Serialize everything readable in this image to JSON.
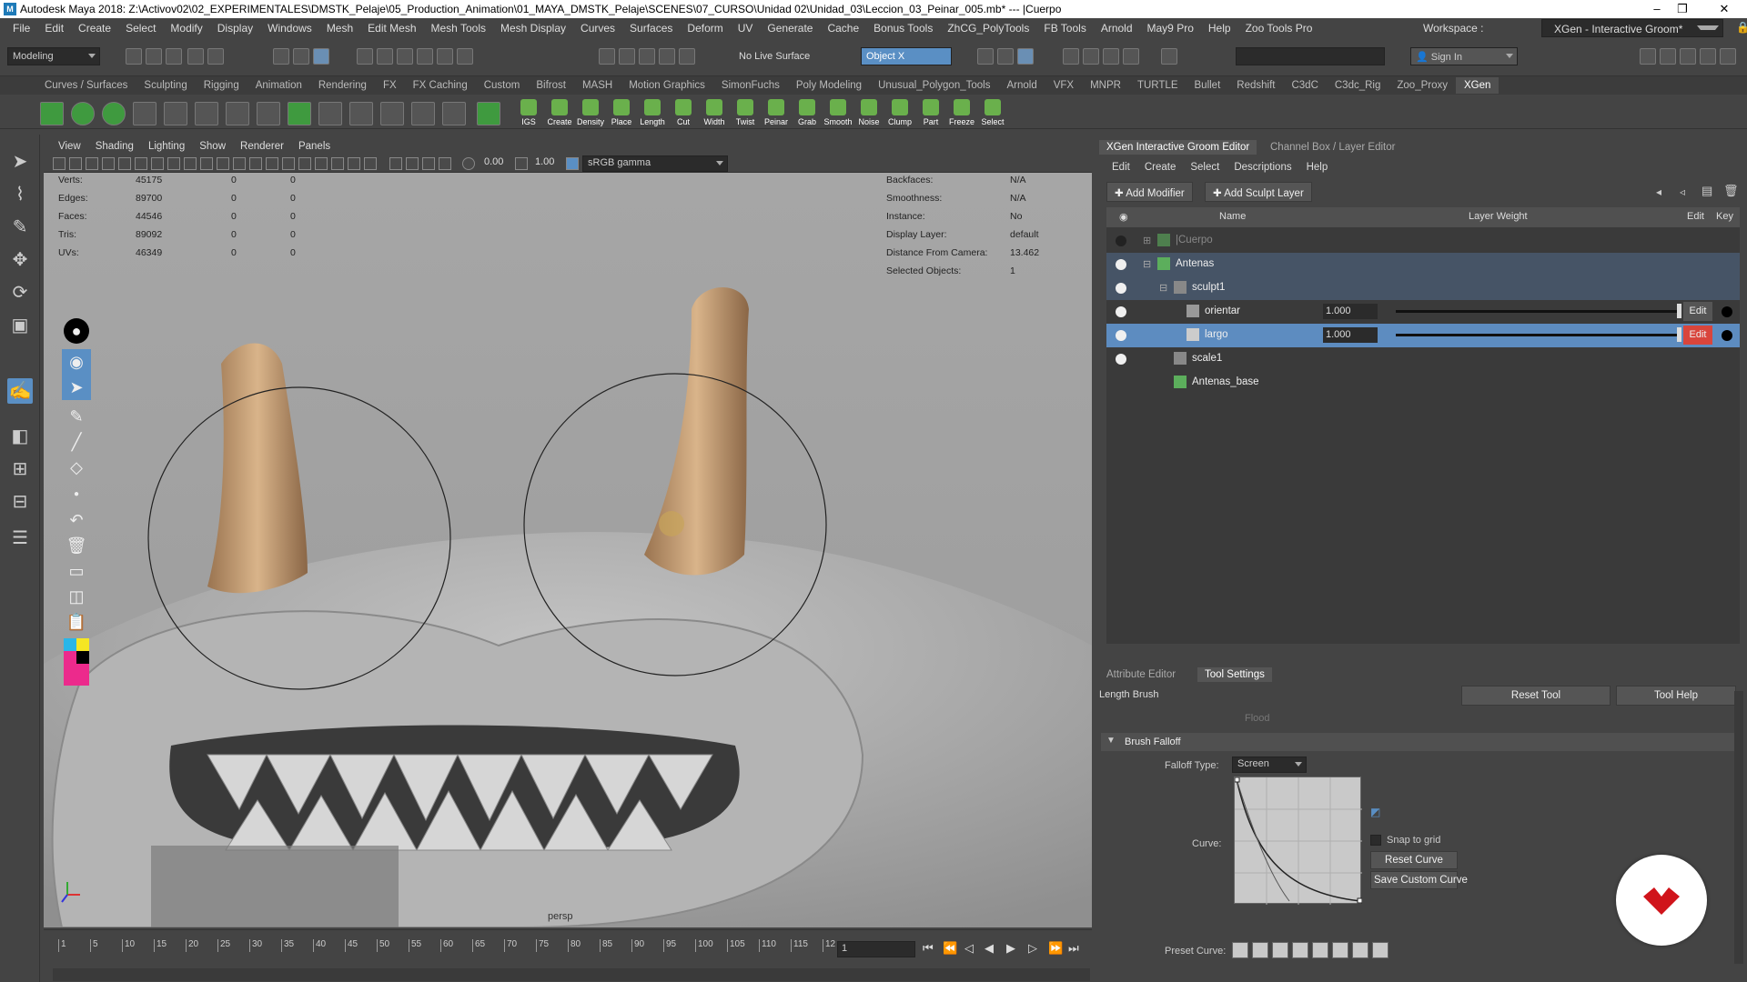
{
  "titlebar": {
    "logo_text": "M",
    "title": "Autodesk Maya 2018: Z:\\Activov02\\02_EXPERIMENTALES\\DMSTK_Pelaje\\05_Production_Animation\\01_MAYA_DMSTK_Pelaje\\SCENES\\07_CURSO\\Unidad 02\\Unidad_03\\Leccion_03_Peinar_005.mb* --- |Cuerpo",
    "minimize": "–",
    "maximize": "❐",
    "close": "✕"
  },
  "menubar": [
    "File",
    "Edit",
    "Create",
    "Select",
    "Modify",
    "Display",
    "Windows",
    "Mesh",
    "Edit Mesh",
    "Mesh Tools",
    "Mesh Display",
    "Curves",
    "Surfaces",
    "Deform",
    "UV",
    "Generate",
    "Cache",
    "Bonus Tools",
    "ZhCG_PolyTools",
    "FB Tools",
    "Arnold",
    "May9 Pro",
    "Help",
    "Zoo Tools Pro"
  ],
  "workspace": {
    "label": "Workspace :",
    "value": "XGen - Interactive Groom*"
  },
  "statusline": {
    "mode": "Modeling",
    "live_surface": "No Live Surface",
    "object_field": "Object X",
    "sign_in": "Sign In"
  },
  "shelf_tabs": [
    "Curves / Surfaces",
    "Sculpting",
    "Rigging",
    "Animation",
    "Rendering",
    "FX",
    "FX Caching",
    "Custom",
    "Bifrost",
    "MASH",
    "Motion Graphics",
    "SimonFuchs",
    "Poly Modeling",
    "Unusual_Polygon_Tools",
    "Arnold",
    "VFX",
    "MNPR",
    "TURTLE",
    "Bullet",
    "Redshift",
    "C3dC",
    "C3dc_Rig",
    "Zoo_Proxy",
    "XGen"
  ],
  "shelf_active": "XGen",
  "shelf_buttons": [
    "IGS",
    "Create",
    "Density",
    "Place",
    "Length",
    "Cut",
    "Width",
    "Twist",
    "Peinar",
    "Grab",
    "Smooth",
    "Noise",
    "Clump",
    "Part",
    "Freeze",
    "Select"
  ],
  "viewport_menu": [
    "View",
    "Shading",
    "Lighting",
    "Show",
    "Renderer",
    "Panels"
  ],
  "viewport_toolbar": {
    "exposure": "0.00",
    "gamma": "1.00",
    "color_space": "sRGB gamma"
  },
  "hud_left": [
    {
      "k": "Verts:",
      "v1": "45175",
      "v2": "0",
      "v3": "0"
    },
    {
      "k": "Edges:",
      "v1": "89700",
      "v2": "0",
      "v3": "0"
    },
    {
      "k": "Faces:",
      "v1": "44546",
      "v2": "0",
      "v3": "0"
    },
    {
      "k": "Tris:",
      "v1": "89092",
      "v2": "0",
      "v3": "0"
    },
    {
      "k": "UVs:",
      "v1": "46349",
      "v2": "0",
      "v3": "0"
    }
  ],
  "hud_right": [
    {
      "k": "Backfaces:",
      "v": "N/A"
    },
    {
      "k": "Smoothness:",
      "v": "N/A"
    },
    {
      "k": "Instance:",
      "v": "No"
    },
    {
      "k": "Display Layer:",
      "v": "default"
    },
    {
      "k": "Distance From Camera:",
      "v": "13.462"
    },
    {
      "k": "Selected Objects:",
      "v": "1"
    }
  ],
  "camera_label": "persp",
  "timeline": {
    "ticks": [
      "1",
      "5",
      "10",
      "15",
      "20",
      "25",
      "30",
      "35",
      "40",
      "45",
      "50",
      "55",
      "60",
      "65",
      "70",
      "75",
      "80",
      "85",
      "90",
      "95",
      "100",
      "105",
      "110",
      "115",
      "12"
    ],
    "current_frame": "1"
  },
  "right_panel": {
    "tabs": [
      "XGen Interactive Groom Editor",
      "Channel Box / Layer Editor"
    ],
    "groom_menu": [
      "Edit",
      "Create",
      "Select",
      "Descriptions",
      "Help"
    ],
    "add_modifier": "Add Modifier",
    "add_sculpt_layer": "Add Sculpt Layer",
    "table_headers": {
      "name": "Name",
      "weight": "Layer Weight",
      "edit": "Edit",
      "key": "Key"
    },
    "rows": [
      {
        "name": "|Cuerpo",
        "indent": 0,
        "dim": true
      },
      {
        "name": "Antenas",
        "indent": 0
      },
      {
        "name": "sculpt1",
        "indent": 1
      },
      {
        "name": "orientar",
        "indent": 2,
        "weight": "1.000",
        "edit": "Edit"
      },
      {
        "name": "largo",
        "indent": 2,
        "weight": "1.000",
        "edit": "Edit",
        "selected": true
      },
      {
        "name": "scale1",
        "indent": 1
      },
      {
        "name": "Antenas_base",
        "indent": 1
      }
    ]
  },
  "tool_settings": {
    "tabs": [
      "Attribute Editor",
      "Tool Settings"
    ],
    "tool_name": "Length Brush",
    "reset_tool": "Reset Tool",
    "tool_help": "Tool Help",
    "flood": "Flood",
    "section": "Brush Falloff",
    "falloff_type_label": "Falloff Type:",
    "falloff_type": "Screen",
    "curve_label": "Curve:",
    "snap_to_grid": "Snap to grid",
    "reset_curve": "Reset Curve",
    "save_custom_curve": "Save Custom Curve",
    "preset_curve_label": "Preset Curve:"
  },
  "colors": {
    "selected_row": "#5d8cc0",
    "edit_red": "#d9453c",
    "xgen_green": "#5cae5c"
  }
}
